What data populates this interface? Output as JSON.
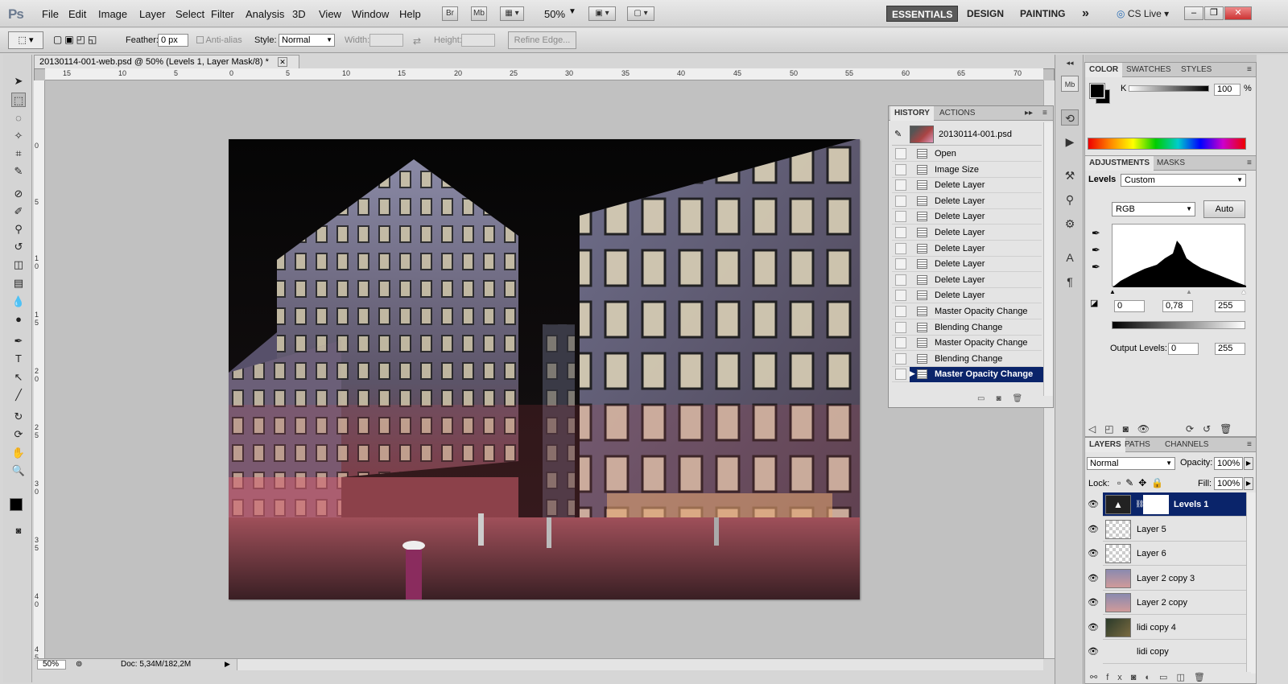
{
  "app": {
    "logo": "Ps"
  },
  "menu": [
    "File",
    "Edit",
    "Image",
    "Layer",
    "Select",
    "Filter",
    "Analysis",
    "3D",
    "View",
    "Window",
    "Help"
  ],
  "appbar": {
    "bridge": "Br",
    "minibridge": "Mb",
    "zoom": "50%"
  },
  "workspaces": {
    "essentials": "ESSENTIALS",
    "design": "DESIGN",
    "painting": "PAINTING",
    "more": "»",
    "cslive": "CS Live"
  },
  "options": {
    "feather_label": "Feather:",
    "feather_value": "0 px",
    "antialias": "Anti-alias",
    "style_label": "Style:",
    "style_value": "Normal",
    "width_label": "Width:",
    "height_label": "Height:",
    "refine": "Refine Edge..."
  },
  "document": {
    "tab_title": "20130114-001-web.psd @ 50% (Levels 1, Layer Mask/8) *",
    "zoom": "50%",
    "doc_info": "Doc: 5,34M/182,2M"
  },
  "ruler": {
    "h": [
      "15",
      "10",
      "5",
      "0",
      "5",
      "10",
      "15",
      "20",
      "25",
      "30",
      "35",
      "40",
      "45",
      "50",
      "55",
      "60",
      "65",
      "70"
    ],
    "v": [
      "0",
      "5",
      "1 0",
      "1 5",
      "2 0",
      "2 5",
      "3 0",
      "3 5",
      "4 0",
      "4 5"
    ]
  },
  "history": {
    "tabs": [
      "HISTORY",
      "ACTIONS"
    ],
    "snapshot": "20130114-001.psd",
    "items": [
      "Open",
      "Image Size",
      "Delete Layer",
      "Delete Layer",
      "Delete Layer",
      "Delete Layer",
      "Delete Layer",
      "Delete Layer",
      "Delete Layer",
      "Delete Layer",
      "Master Opacity Change",
      "Blending Change",
      "Master Opacity Change",
      "Blending Change",
      "Master Opacity Change"
    ],
    "selected_index": 14
  },
  "color": {
    "tabs": [
      "COLOR",
      "SWATCHES",
      "STYLES"
    ],
    "channel": "K",
    "value": "100",
    "unit": "%"
  },
  "adjustments": {
    "tabs": [
      "ADJUSTMENTS",
      "MASKS"
    ],
    "label": "Levels",
    "preset": "Custom",
    "channel": "RGB",
    "auto": "Auto",
    "input_black": "0",
    "input_gamma": "0,78",
    "input_white": "255",
    "output_label": "Output Levels:",
    "output_black": "0",
    "output_white": "255"
  },
  "layers": {
    "tabs": [
      "LAYERS",
      "PATHS",
      "CHANNELS"
    ],
    "blend": "Normal",
    "opacity_label": "Opacity:",
    "opacity": "100%",
    "lock_label": "Lock:",
    "fill_label": "Fill:",
    "fill": "100%",
    "items": [
      {
        "name": "Levels 1",
        "selected": true
      },
      {
        "name": "Layer 5"
      },
      {
        "name": "Layer 6"
      },
      {
        "name": "Layer 2 copy 3"
      },
      {
        "name": "Layer 2 copy"
      },
      {
        "name": "lidi copy 4"
      },
      {
        "name": "lidi copy"
      }
    ]
  }
}
